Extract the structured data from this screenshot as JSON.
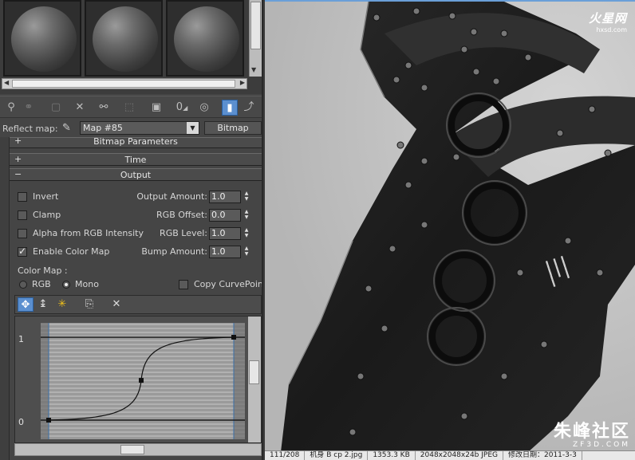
{
  "toolbar": {
    "icons": [
      "get-material-icon",
      "assign-material-icon",
      "reset-map-icon",
      "delete-icon",
      "make-unique-icon",
      "put-to-library-icon",
      "material-id-icon",
      "show-map-icon",
      "show-end-result-icon",
      "go-parent-icon",
      "go-sibling-icon"
    ],
    "mat_id_label": "0"
  },
  "reflect": {
    "label": "Reflect map:",
    "map_name": "Map #85",
    "type_button": "Bitmap"
  },
  "rollouts": {
    "bitmap_params": {
      "sign": "+",
      "title": "Bitmap Parameters"
    },
    "time": {
      "sign": "+",
      "title": "Time"
    },
    "output": {
      "sign": "−",
      "title": "Output"
    }
  },
  "output": {
    "invert": {
      "label": "Invert",
      "checked": false
    },
    "clamp": {
      "label": "Clamp",
      "checked": false
    },
    "alpha_from_rgb": {
      "label": "Alpha from RGB Intensity",
      "checked": false
    },
    "enable_color_map": {
      "label": "Enable Color Map",
      "checked": true
    },
    "output_amount": {
      "label": "Output Amount:",
      "value": "1.0"
    },
    "rgb_offset": {
      "label": "RGB Offset:",
      "value": "0.0"
    },
    "rgb_level": {
      "label": "RGB Level:",
      "value": "1.0"
    },
    "bump_amount": {
      "label": "Bump Amount:",
      "value": "1.0"
    }
  },
  "color_map": {
    "label": "Color Map :",
    "rgb_label": "RGB",
    "mono_label": "Mono",
    "selected": "Mono",
    "copy_curve_points": {
      "label": "Copy CurvePoints",
      "checked": false
    },
    "axis_top": "1",
    "axis_bottom": "0",
    "curve_points": [
      [
        0.0,
        0.0
      ],
      [
        0.5,
        0.48
      ],
      [
        1.0,
        1.0
      ]
    ]
  },
  "viewer": {
    "watermark_top_brand": "火星网",
    "watermark_top_domain": "hxsd.com",
    "watermark_bottom_brand": "朱峰社区",
    "watermark_bottom_domain": "ZF3D.COM",
    "status": {
      "index": "111/208",
      "file": "机身 B cp 2.jpg",
      "size": "1353.3 KB",
      "dims": "2048x2048x24b JPEG",
      "date": "修改日期：2011-3-3"
    }
  }
}
